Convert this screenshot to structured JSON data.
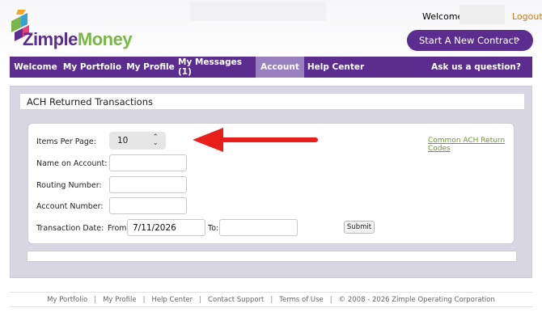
{
  "header": {
    "logo_text_a": "Zimple",
    "logo_text_b": "Money",
    "welcome": "Welcome,",
    "logout": "Logout",
    "new_contract": "Start A New Contract",
    "chevron": "›"
  },
  "nav": {
    "items": [
      "Welcome",
      "My Portfolio",
      "My Profile",
      "My Messages (1)",
      "Account",
      "Help Center"
    ],
    "active": "Account",
    "ask": "Ask us a question?"
  },
  "page": {
    "title": "ACH Returned Transactions"
  },
  "form": {
    "items_per_page_label": "Items Per Page:",
    "items_per_page_value": "10",
    "name_label": "Name on Account:",
    "routing_label": "Routing Number:",
    "account_label": "Account Number:",
    "date_label": "Transaction Date:",
    "from_label": "From:",
    "from_value": "7/11/2026",
    "to_label": "To:",
    "submit": "Submit",
    "ach_codes_link": "Common ACH Return Codes"
  },
  "footer": {
    "links": [
      "My Portfolio",
      "My Profile",
      "Help Center",
      "Contact Support",
      "Terms of Use"
    ],
    "copyright": "© 2008 - 2026 Zimple Operating Corporation"
  },
  "colors": {
    "brand_purple": "#5b2d8e",
    "brand_green": "#7ab648",
    "active_tab": "#9a7fbf",
    "arrow_red": "#e8201c"
  }
}
